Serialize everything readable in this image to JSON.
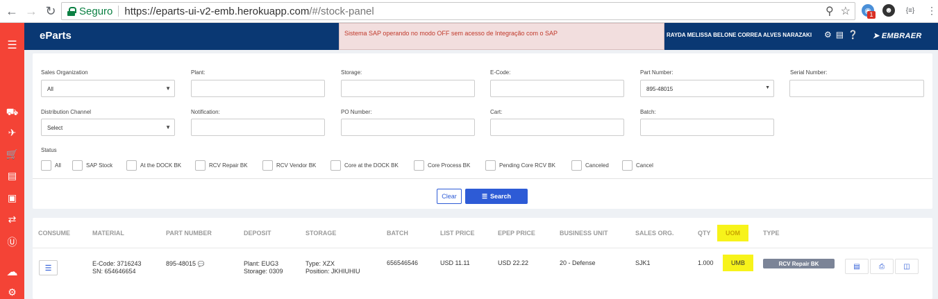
{
  "browser": {
    "secure_label": "Seguro",
    "url_host": "https://eparts-ui-v2-emb.herokuapp.com",
    "url_rest": "/#/stock-panel",
    "ext_badge": "1"
  },
  "app": {
    "brand": "eParts",
    "sap_alert": "Sistema SAP operando no modo OFF sem acesso de Integração com o SAP",
    "user_name": "RAYDA MELISSA BELONE CORREA ALVES NARAZAKI",
    "logo": "EMBRAER"
  },
  "filters": {
    "sales_org": {
      "label": "Sales Organization",
      "value": "All"
    },
    "plant": {
      "label": "Plant:",
      "value": ""
    },
    "storage": {
      "label": "Storage:",
      "value": ""
    },
    "ecode": {
      "label": "E-Code:",
      "value": ""
    },
    "part_number": {
      "label": "Part Number:",
      "value": "895-48015"
    },
    "serial_number": {
      "label": "Serial Number:",
      "value": ""
    },
    "dist_channel": {
      "label": "Distribution Channel",
      "value": "Select"
    },
    "notification": {
      "label": "Notification:",
      "value": ""
    },
    "po_number": {
      "label": "PO Number:",
      "value": ""
    },
    "cart": {
      "label": "Cart:",
      "value": ""
    },
    "batch": {
      "label": "Batch:",
      "value": ""
    },
    "status_label": "Status",
    "status_options": [
      "All",
      "SAP Stock",
      "At the DOCK BK",
      "RCV Repair BK",
      "RCV Vendor BK",
      "Core at the DOCK BK",
      "Core Process BK",
      "Pending Core RCV BK",
      "Canceled",
      "Cancel"
    ],
    "clear_label": "Clear",
    "search_label": "Search"
  },
  "table": {
    "headers": [
      "CONSUME",
      "MATERIAL",
      "PART NUMBER",
      "DEPOSIT",
      "STORAGE",
      "BATCH",
      "LIST PRICE",
      "EPEP PRICE",
      "BUSINESS UNIT",
      "SALES ORG.",
      "QTY",
      "UOM",
      "TYPE"
    ],
    "rows": [
      {
        "material_ecode": "E-Code: 3716243",
        "material_sn": "SN: 654646654",
        "part_number": "895-48015",
        "deposit_plant": "Plant: EUG3",
        "deposit_storage": "Storage: 0309",
        "storage_type": "Type: XZX",
        "storage_position": "Position: JKHIUHIU",
        "batch": "656546546",
        "list_price": "USD 11.11",
        "epep_price": "USD 22.22",
        "business_unit": "20 - Defense",
        "sales_org": "SJK1",
        "qty": "1.000",
        "uom": "UMB",
        "type": "RCV Repair BK"
      }
    ]
  },
  "colors": {
    "sidebar": "#f44336",
    "topbar": "#0a3873",
    "primary": "#2d5bd6",
    "highlight": "#f7f31a"
  }
}
